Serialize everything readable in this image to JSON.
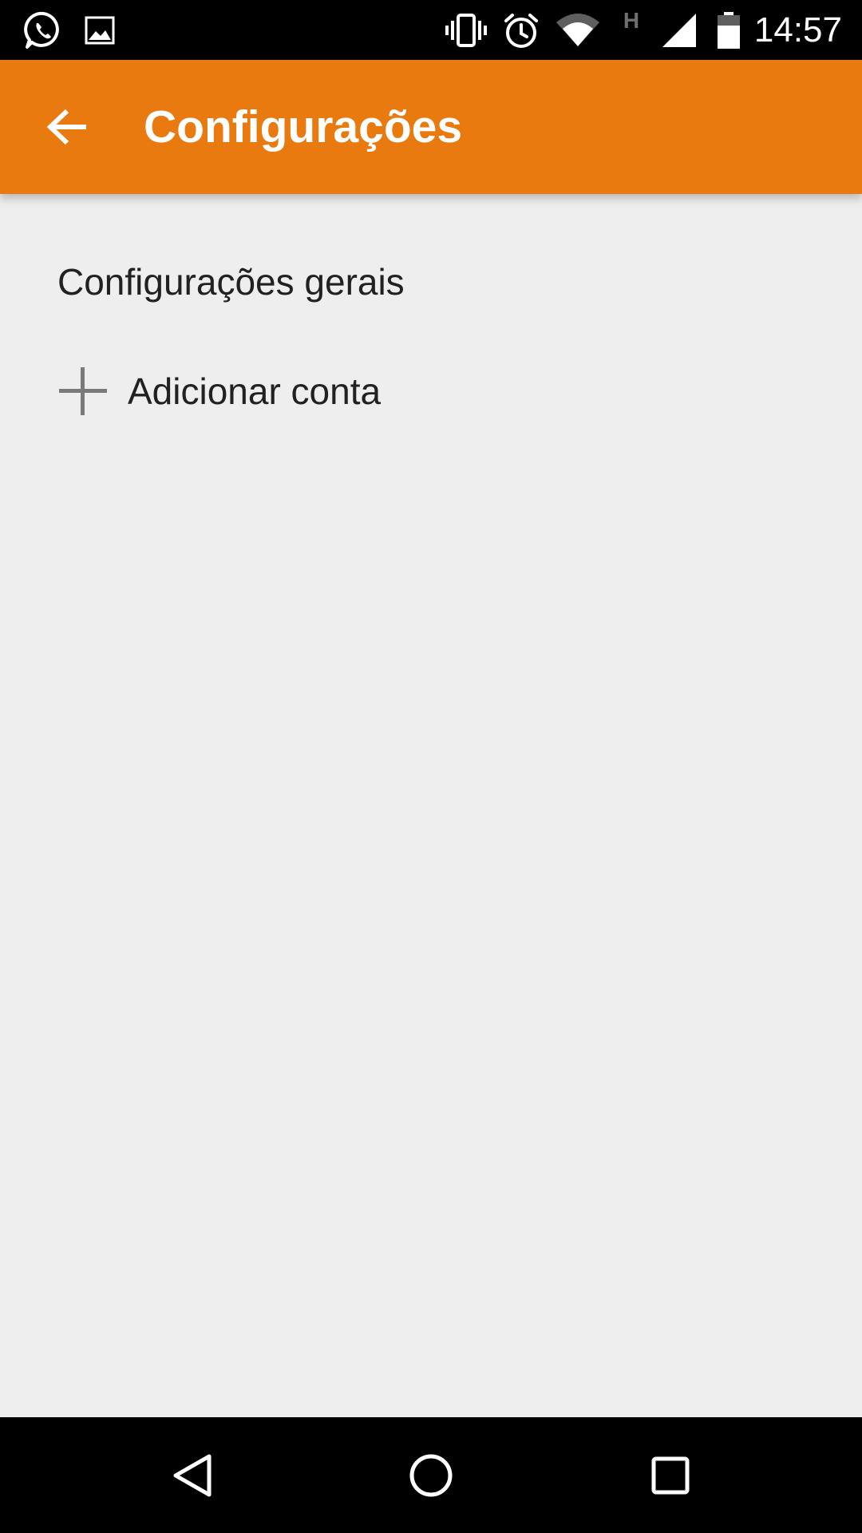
{
  "status_bar": {
    "time": "14:57",
    "network_type": "H",
    "left_icons": [
      "whatsapp-icon",
      "image-icon"
    ],
    "right_icons": [
      "vibrate-icon",
      "alarm-icon",
      "wifi-icon",
      "network-h-icon",
      "signal-icon",
      "battery-icon"
    ]
  },
  "app_bar": {
    "title": "Configurações",
    "back_icon": "arrow-back-icon",
    "background_color": "#e87a0f"
  },
  "settings": {
    "items": [
      {
        "label": "Configurações gerais"
      },
      {
        "label": "Adicionar conta",
        "icon": "plus-icon"
      }
    ]
  },
  "nav_bar": {
    "buttons": [
      "back-triangle-icon",
      "home-circle-icon",
      "recents-square-icon"
    ]
  }
}
